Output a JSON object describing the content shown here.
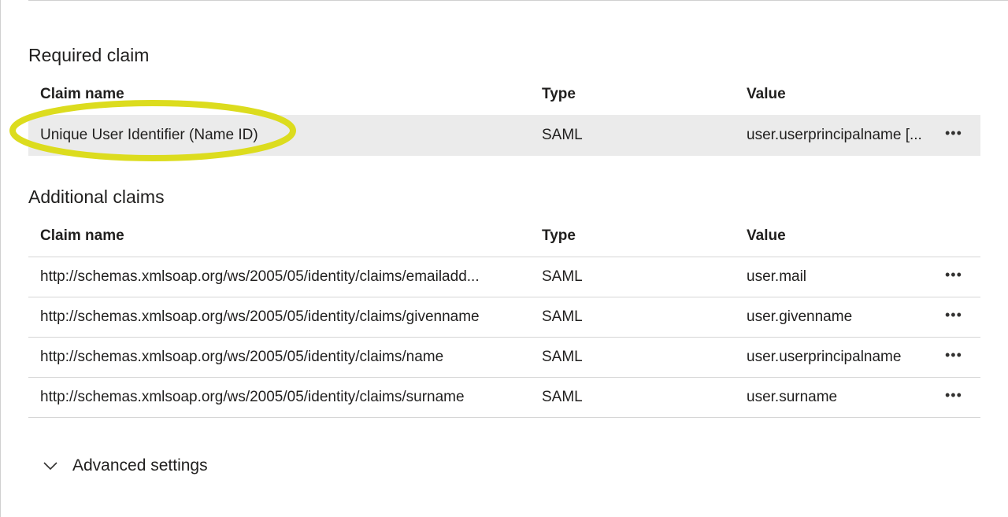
{
  "required": {
    "title": "Required claim",
    "headers": {
      "claim_name": "Claim name",
      "type": "Type",
      "value": "Value"
    },
    "rows": [
      {
        "claim_name": "Unique User Identifier (Name ID)",
        "type": "SAML",
        "value": "user.userprincipalname [...",
        "more": "•••"
      }
    ]
  },
  "additional": {
    "title": "Additional claims",
    "headers": {
      "claim_name": "Claim name",
      "type": "Type",
      "value": "Value"
    },
    "rows": [
      {
        "claim_name": "http://schemas.xmlsoap.org/ws/2005/05/identity/claims/emailadd...",
        "type": "SAML",
        "value": "user.mail",
        "more": "•••"
      },
      {
        "claim_name": "http://schemas.xmlsoap.org/ws/2005/05/identity/claims/givenname",
        "type": "SAML",
        "value": "user.givenname",
        "more": "•••"
      },
      {
        "claim_name": "http://schemas.xmlsoap.org/ws/2005/05/identity/claims/name",
        "type": "SAML",
        "value": "user.userprincipalname",
        "more": "•••"
      },
      {
        "claim_name": "http://schemas.xmlsoap.org/ws/2005/05/identity/claims/surname",
        "type": "SAML",
        "value": "user.surname",
        "more": "•••"
      }
    ]
  },
  "advanced": {
    "label": "Advanced settings",
    "icon": "chevron-down-icon"
  },
  "colors": {
    "highlight": "#dcdc1e",
    "selected_row": "#ebebeb",
    "divider": "#d6d6d6"
  }
}
